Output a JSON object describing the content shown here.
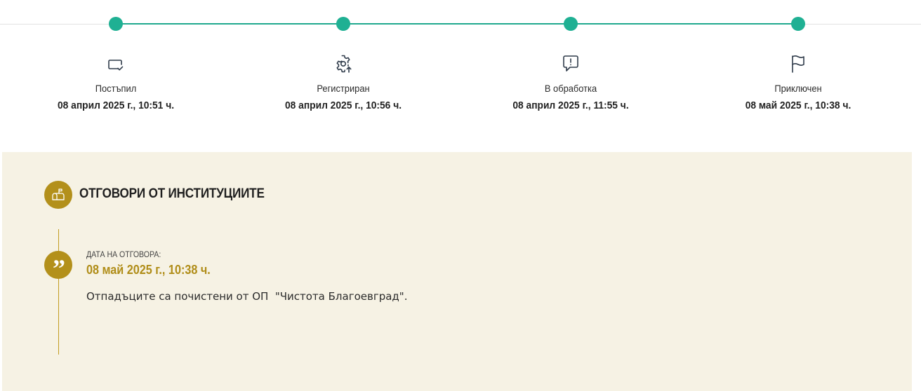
{
  "timeline": {
    "steps": [
      {
        "label": "Постъпил",
        "date": "08 април 2025 г., 10:51 ч.",
        "icon": "card-check-icon"
      },
      {
        "label": "Регистриран",
        "date": "08 април 2025 г., 10:56 ч.",
        "icon": "gear-upload-icon"
      },
      {
        "label": "В обработка",
        "date": "08 април 2025 г., 11:55 ч.",
        "icon": "message-alert-icon"
      },
      {
        "label": "Приключен",
        "date": "08 май 2025 г., 10:38 ч.",
        "icon": "flag-icon"
      }
    ],
    "progress": 1.0,
    "accent_color": "#1fb093"
  },
  "responses": {
    "title": "ОТГОВОРИ ОТ ИНСТИТУЦИИТЕ",
    "icon": "mailbox-icon",
    "background_color": "#f6f2e4",
    "accent_color": "#b3901b",
    "items": [
      {
        "date_label": "ДАТА НА ОТГОВОРА:",
        "date": "08 май 2025 г., 10:38 ч.",
        "text": "Отпадъците са почистени от ОП  \"Чистота Благоевград\".",
        "icon": "quote-icon"
      }
    ]
  }
}
